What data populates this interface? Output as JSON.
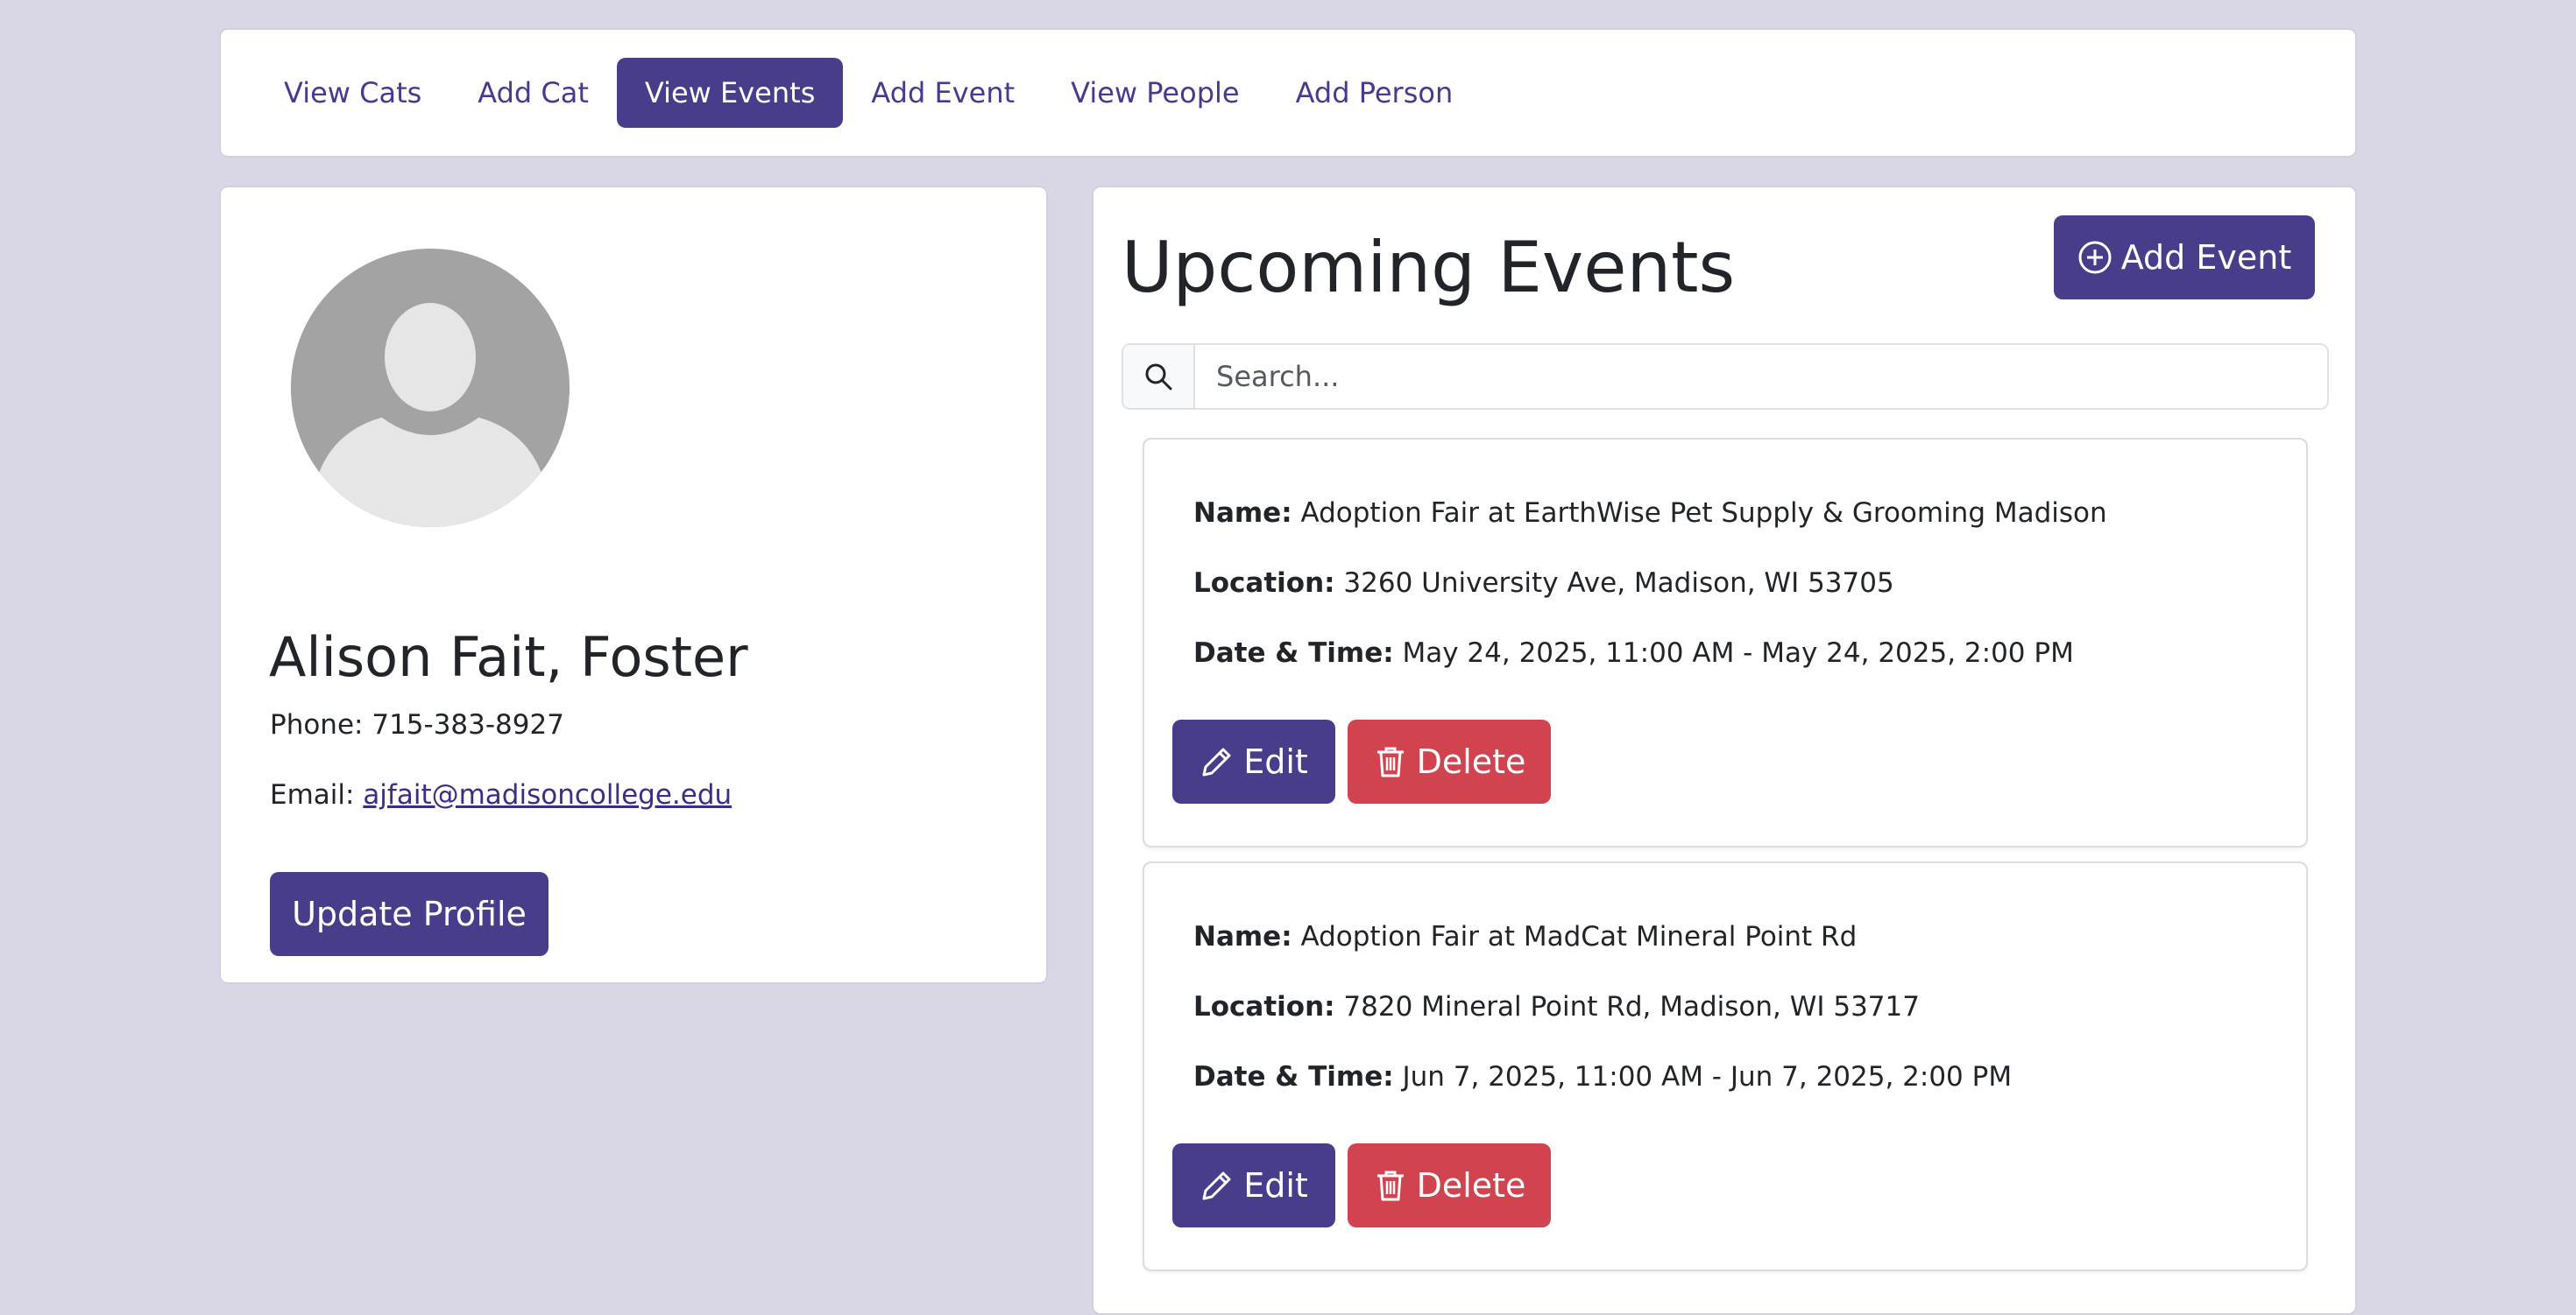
{
  "nav": {
    "items": [
      {
        "label": "View Cats"
      },
      {
        "label": "Add Cat"
      },
      {
        "label": "View Events",
        "active": true
      },
      {
        "label": "Add Event"
      },
      {
        "label": "View People"
      },
      {
        "label": "Add Person"
      }
    ]
  },
  "profile": {
    "name": "Alison Fait, Foster",
    "phone_label": "Phone:",
    "phone": "715-383-8927",
    "email_label": "Email:",
    "email": "ajfait@madisoncollege.edu",
    "update_label": "Update Profile"
  },
  "events": {
    "title": "Upcoming Events",
    "add_label": "Add Event",
    "search_placeholder": "Search...",
    "name_label": "Name:",
    "location_label": "Location:",
    "datetime_label": "Date & Time:",
    "edit_label": "Edit",
    "delete_label": "Delete",
    "items": [
      {
        "name": "Adoption Fair at EarthWise Pet Supply & Grooming Madison",
        "location": "3260 University Ave, Madison, WI 53705",
        "datetime": "May 24, 2025, 11:00 AM - May 24, 2025, 2:00 PM"
      },
      {
        "name": "Adoption Fair at MadCat Mineral Point Rd",
        "location": "7820 Mineral Point Rd, Madison, WI 53717",
        "datetime": "Jun 7, 2025, 11:00 AM - Jun 7, 2025, 2:00 PM"
      }
    ]
  },
  "colors": {
    "background": "#d9d7e6",
    "primary": "#483d8b",
    "danger": "#d0434f",
    "link": "#3a2f86"
  },
  "icons": {
    "search": "search-icon",
    "add": "plus-circle-icon",
    "edit": "pencil-icon",
    "delete": "trash-icon",
    "avatar": "user-avatar-placeholder"
  }
}
